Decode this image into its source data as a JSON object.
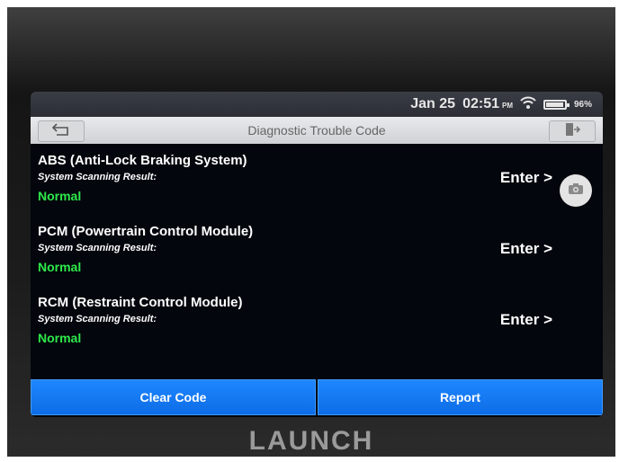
{
  "status_bar": {
    "date": "Jan 25",
    "time": "02:51",
    "ampm": "PM",
    "battery_percent": "96%",
    "battery_level": 0.96,
    "icons": [
      "wifi-icon",
      "battery-icon"
    ]
  },
  "title_bar": {
    "title": "Diagnostic Trouble Code",
    "left_icon": "back-arrow-icon",
    "right_icon": "exit-door-icon"
  },
  "modules": [
    {
      "name": "ABS (Anti-Lock Braking System)",
      "result_label": "System Scanning Result:",
      "result": "Normal",
      "action": "Enter >"
    },
    {
      "name": "PCM (Powertrain Control Module)",
      "result_label": "System Scanning Result:",
      "result": "Normal",
      "action": "Enter >"
    },
    {
      "name": "RCM (Restraint Control Module)",
      "result_label": "System Scanning Result:",
      "result": "Normal",
      "action": "Enter >"
    }
  ],
  "floating": {
    "icon": "camera-icon"
  },
  "bottom_bar": {
    "clear_code": "Clear Code",
    "report": "Report"
  },
  "brand": "LAUNCH",
  "colors": {
    "accent": "#1e86ff",
    "normal": "#2ee84a",
    "screen_bg": "#03060c"
  }
}
